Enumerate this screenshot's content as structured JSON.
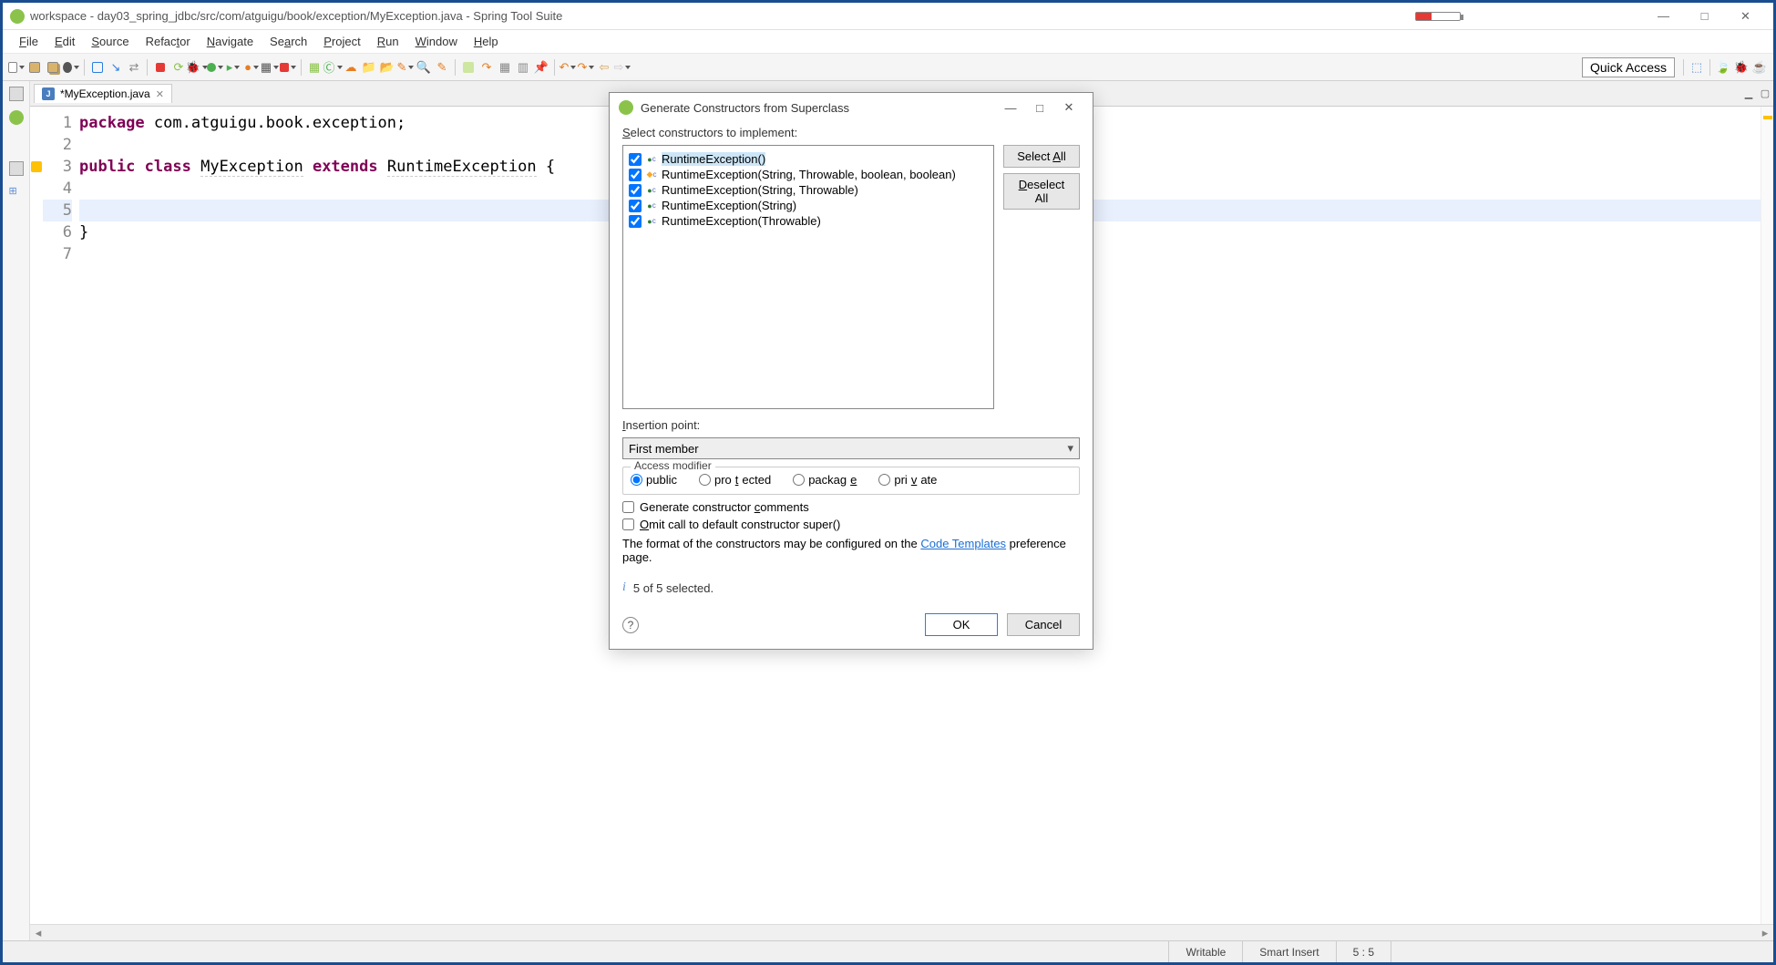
{
  "window": {
    "title": "workspace - day03_spring_jdbc/src/com/atguigu/book/exception/MyException.java - Spring Tool Suite",
    "minimize": "—",
    "maximize": "□",
    "close": "✕"
  },
  "menu": [
    "File",
    "Edit",
    "Source",
    "Refactor",
    "Navigate",
    "Search",
    "Project",
    "Run",
    "Window",
    "Help"
  ],
  "quick_access_label": "Quick Access",
  "tab": {
    "name": "*MyException.java"
  },
  "code": {
    "lines": [
      "1",
      "2",
      "3",
      "4",
      "5",
      "6",
      "7"
    ],
    "l1a": "package",
    "l1b": " com.atguigu.book.exception;",
    "l3a": "public",
    "l3b": " ",
    "l3c": "class",
    "l3d": " ",
    "l3e": "MyException",
    "l3f": " ",
    "l3g": "extends",
    "l3h": " ",
    "l3i": "RuntimeException",
    "l3j": " {",
    "l6": "}"
  },
  "dialog": {
    "title": "Generate Constructors from Superclass",
    "select_label": "Select constructors to implement:",
    "items": [
      {
        "checked": true,
        "vis": "green",
        "text": "RuntimeException()",
        "selected": true
      },
      {
        "checked": true,
        "vis": "yellow",
        "text": "RuntimeException(String, Throwable, boolean, boolean)"
      },
      {
        "checked": true,
        "vis": "green",
        "text": "RuntimeException(String, Throwable)"
      },
      {
        "checked": true,
        "vis": "green",
        "text": "RuntimeException(String)"
      },
      {
        "checked": true,
        "vis": "green",
        "text": "RuntimeException(Throwable)"
      }
    ],
    "select_all": "Select All",
    "deselect_all": "Deselect All",
    "insertion_label": "Insertion point:",
    "insertion_value": "First member",
    "access_label": "Access modifier",
    "access": {
      "public": "public",
      "protected": "protected",
      "package": "package",
      "private": "private"
    },
    "gen_comments": "Generate constructor comments",
    "omit_call": "Omit call to default constructor super()",
    "format_text_a": "The format of the constructors may be configured on the ",
    "format_link": "Code Templates",
    "format_text_b": " preference page.",
    "count": "5 of 5 selected.",
    "ok": "OK",
    "cancel": "Cancel"
  },
  "status": {
    "writable": "Writable",
    "insert": "Smart Insert",
    "pos": "5 : 5"
  }
}
